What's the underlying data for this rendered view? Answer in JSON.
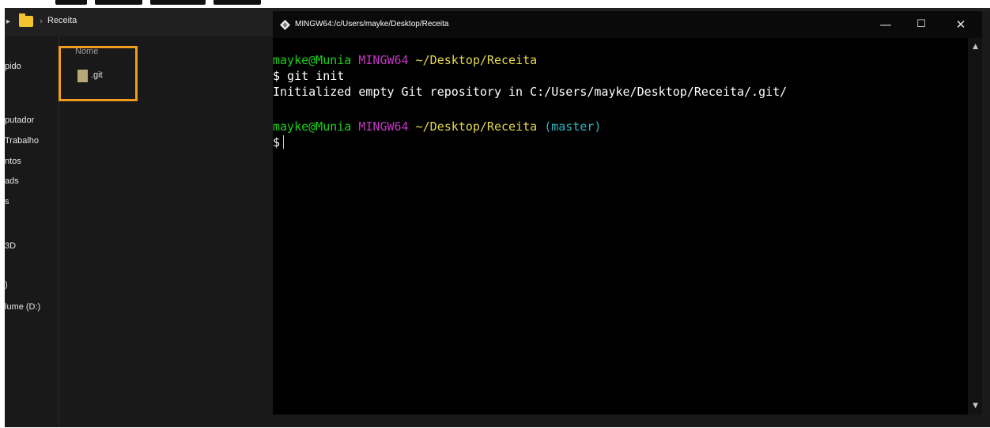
{
  "explorer": {
    "breadcrumb": "Receita",
    "nav_items": [
      "pido",
      "putador",
      "Trabalho",
      "ntos",
      "ads",
      "s",
      "3D",
      ")",
      "lume (D:)"
    ],
    "column_header": "Nome",
    "files": [
      ".git"
    ]
  },
  "terminal": {
    "title": "MINGW64:/c/Users/mayke/Desktop/Receita",
    "window_controls": {
      "minimize": "—",
      "maximize": "☐",
      "close": "✕"
    },
    "prompt1": {
      "user": "mayke@Munia",
      "env": "MINGW64",
      "path": "~/Desktop/Receita"
    },
    "command": "$ git init",
    "output": "Initialized empty Git repository in C:/Users/mayke/Desktop/Receita/.git/",
    "prompt2": {
      "user": "mayke@Munia",
      "env": "MINGW64",
      "path": "~/Desktop/Receita",
      "branch": "(master)"
    },
    "prompt_symbol": "$"
  },
  "colors": {
    "user": "#1bd11b",
    "env": "#c535c5",
    "path": "#e6d94a",
    "branch": "#29b8c4",
    "highlight": "#f29b21"
  }
}
